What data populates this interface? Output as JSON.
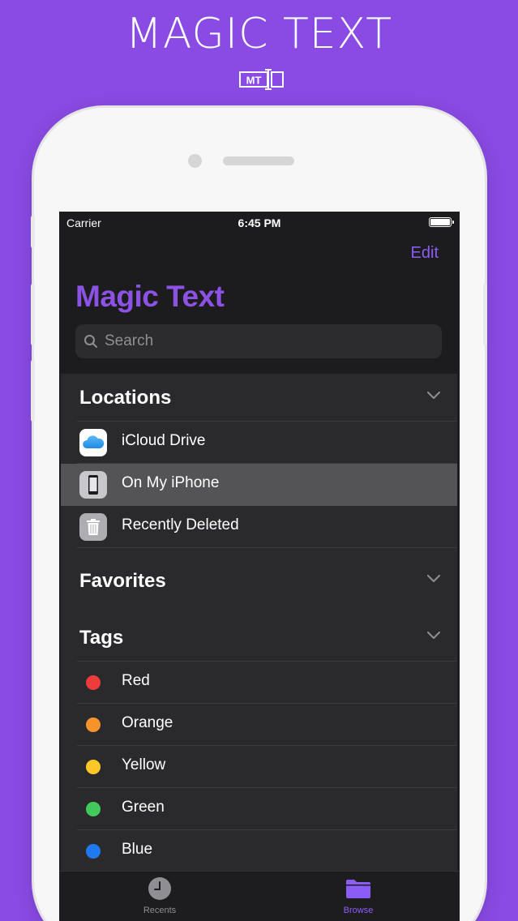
{
  "promo": {
    "title": "MAGIC TEXT",
    "logo_text": "MT"
  },
  "status_bar": {
    "carrier": "Carrier",
    "time": "6:45 PM"
  },
  "nav": {
    "edit_label": "Edit",
    "title": "Magic Text"
  },
  "search": {
    "placeholder": "Search"
  },
  "sections": {
    "locations": {
      "title": "Locations",
      "items": [
        {
          "label": "iCloud Drive",
          "icon": "icloud-icon"
        },
        {
          "label": "On My iPhone",
          "icon": "iphone-icon",
          "selected": true
        },
        {
          "label": "Recently Deleted",
          "icon": "trash-icon"
        }
      ]
    },
    "favorites": {
      "title": "Favorites"
    },
    "tags": {
      "title": "Tags",
      "items": [
        {
          "label": "Red",
          "color": "#ef3b3b"
        },
        {
          "label": "Orange",
          "color": "#f7932b"
        },
        {
          "label": "Yellow",
          "color": "#fdc727"
        },
        {
          "label": "Green",
          "color": "#41ca5b"
        },
        {
          "label": "Blue",
          "color": "#1f7af2"
        }
      ]
    }
  },
  "tab_bar": {
    "recents_label": "Recents",
    "browse_label": "Browse",
    "active": "browse",
    "accent": "#8b5cf6"
  },
  "colors": {
    "background": "#8a4ae4",
    "accent": "#8b5cf6"
  }
}
